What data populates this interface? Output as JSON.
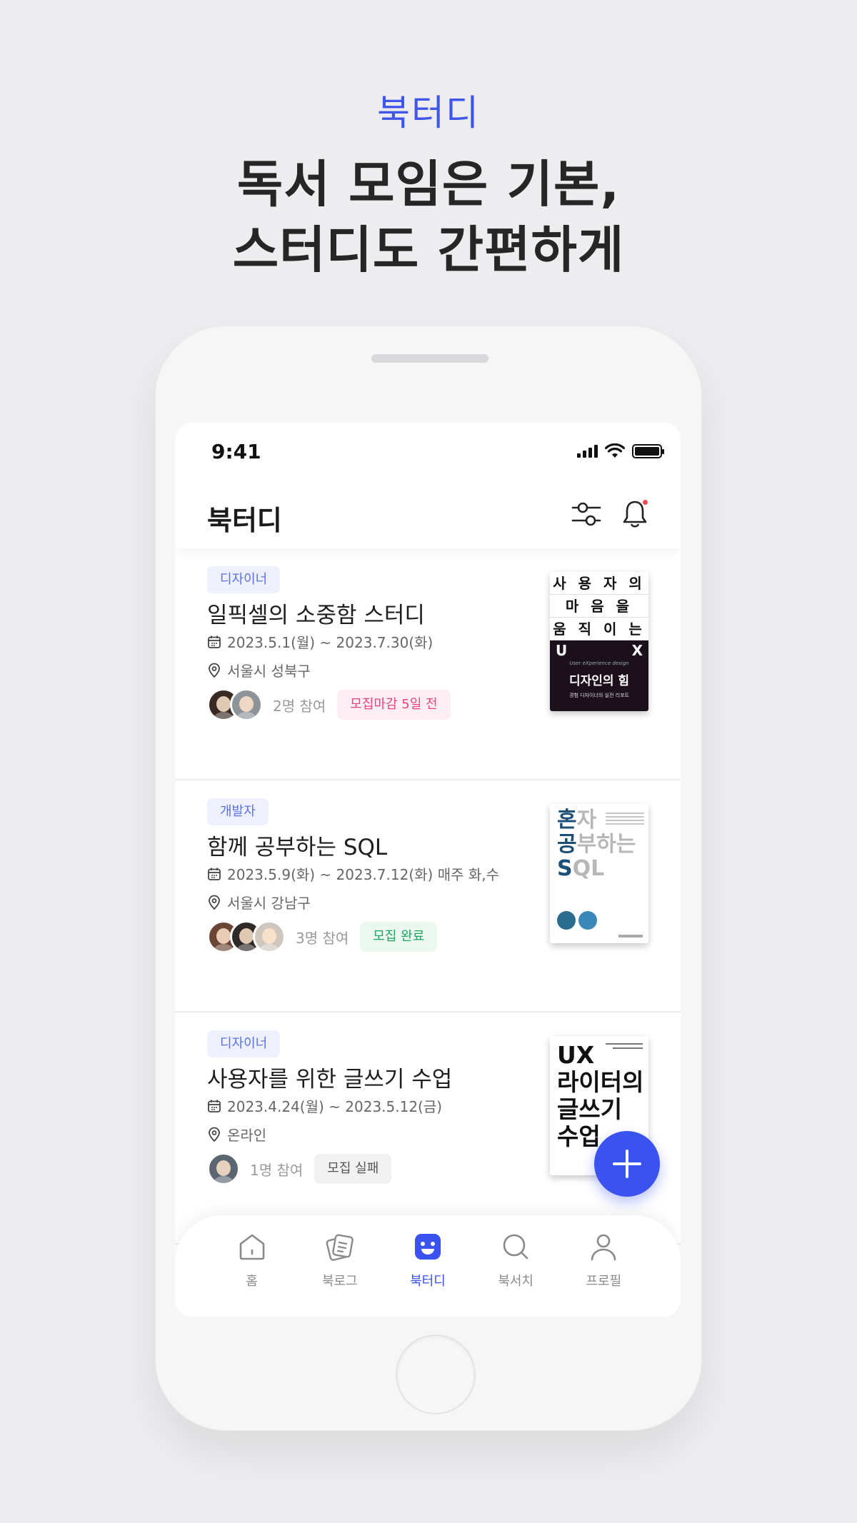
{
  "hero": {
    "kicker": "북터디",
    "title_line1": "독서 모임은 기본,",
    "title_line2": "스터디도 간편하게"
  },
  "status_bar": {
    "time": "9:41"
  },
  "header": {
    "title": "북터디"
  },
  "studies": [
    {
      "tag": "디자이너",
      "title": "일픽셀의 소중함 스터디",
      "date": "2023.5.1(월) ~ 2023.7.30(화)",
      "location": "서울시 성북구",
      "participants": "2명 참여",
      "status": "모집마감 5일 전",
      "status_bg": "#fdeef3",
      "status_color": "#e5457b",
      "book": {
        "lines": [
          "사 용 자 의",
          "마 음 을",
          "움 직 이 는",
          "U",
          "X",
          "디자인의 힘",
          "User eXperience design",
          "경험 디자이너의 실전 리포트"
        ]
      }
    },
    {
      "tag": "개발자",
      "title": "함께 공부하는 SQL",
      "date": "2023.5.9(화) ~ 2023.7.12(화) 매주 화,수",
      "location": "서울시 강남구",
      "participants": "3명 참여",
      "status": "모집 완료",
      "status_bg": "#eaf8f0",
      "status_color": "#1fa561",
      "book": {
        "k1": "혼",
        "g1": "자",
        "k2": "공",
        "g2": "부하는",
        "k3": "S",
        "g3": "QL"
      }
    },
    {
      "tag": "디자이너",
      "title": "사용자를 위한 글쓰기 수업",
      "date": "2023.4.24(월) ~ 2023.5.12(금)",
      "location": "온라인",
      "participants": "1명 참여",
      "status": "모집 실패",
      "status_bg": "#f1f1f2",
      "status_color": "#555555",
      "book": {
        "lines": [
          "UX",
          "라이터의",
          "글쓰기",
          "수업"
        ]
      }
    }
  ],
  "nav": [
    {
      "label": "홈",
      "icon": "home-icon"
    },
    {
      "label": "북로그",
      "icon": "book-log-icon"
    },
    {
      "label": "북터디",
      "icon": "book-study-icon"
    },
    {
      "label": "북서치",
      "icon": "search-icon"
    },
    {
      "label": "프로필",
      "icon": "profile-icon"
    }
  ],
  "colors": {
    "accent": "#3a52ee",
    "kicker": "#3f57e8"
  }
}
